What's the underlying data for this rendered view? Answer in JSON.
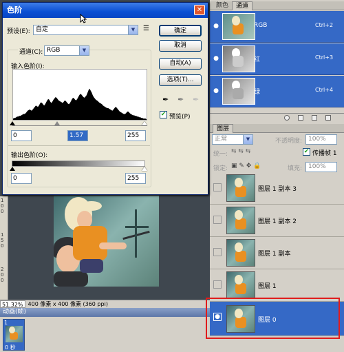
{
  "dialog": {
    "title": "色阶",
    "close_glyph": "✕",
    "preset_label": "预设(E):",
    "preset_value": "自定",
    "channel_label": "通道(C):",
    "channel_value": "RGB",
    "input_levels_label": "输入色阶(I):",
    "input_black": "0",
    "input_gamma": "1.57",
    "input_white": "255",
    "output_levels_label": "输出色阶(O):",
    "output_black": "0",
    "output_white": "255",
    "buttons": {
      "ok": "确定",
      "cancel": "取消",
      "auto": "自动(A)",
      "options": "选项(T)..."
    },
    "preview_label": "预览(P)",
    "preview_checked": true,
    "histogram": [
      2,
      3,
      3,
      4,
      5,
      5,
      6,
      6,
      7,
      8,
      9,
      9,
      10,
      12,
      14,
      15,
      16,
      15,
      14,
      16,
      18,
      20,
      22,
      21,
      20,
      22,
      25,
      27,
      26,
      24,
      22,
      24,
      27,
      30,
      32,
      31,
      28,
      26,
      28,
      31,
      33,
      35,
      34,
      32,
      30,
      29,
      28,
      27,
      26,
      28,
      30,
      29,
      27,
      25,
      24,
      26,
      29,
      32,
      34,
      33,
      31,
      30,
      32,
      35,
      38,
      40,
      39,
      37,
      35,
      34,
      36,
      38,
      42,
      46,
      48,
      45,
      42,
      38,
      35,
      33,
      31,
      30,
      29,
      27,
      26,
      25,
      24,
      22,
      21,
      20,
      19,
      18,
      18,
      17,
      16,
      15,
      14,
      16,
      18,
      20,
      19,
      17,
      15,
      13,
      12,
      11,
      10,
      9,
      9,
      10,
      12,
      13,
      12,
      10,
      9,
      8,
      7,
      7,
      6,
      6,
      5,
      5,
      4,
      4,
      3,
      3,
      2,
      2,
      2,
      1
    ]
  },
  "status_bar": {
    "zoom": "51.32%",
    "doc_info": "400 像素 x 400 像素 (360 ppi)"
  },
  "ruler_marks": [
    "1",
    "0",
    "0",
    "1",
    "5",
    "0",
    "2",
    "0",
    "0"
  ],
  "animation": {
    "title": "动画(帧)",
    "frame_number": "1",
    "frame_time": "0 秒"
  },
  "channels_panel": {
    "tabs": [
      "颜色",
      "通道"
    ],
    "channels": [
      {
        "name": "RGB",
        "shortcut": "Ctrl+2"
      },
      {
        "name": "红",
        "shortcut": "Ctrl+3"
      },
      {
        "name": "绿",
        "shortcut": "Ctrl+4"
      }
    ]
  },
  "layers_panel": {
    "title": "图层",
    "blend_mode": "正常",
    "opacity_label": "不透明度:",
    "opacity_value": "100%",
    "unify_label": "统一:",
    "propagate_label": "传播帧 1",
    "lock_label": "锁定:",
    "fill_label": "填充:",
    "fill_value": "100%",
    "layers": [
      {
        "name": "图层 1 副本 3",
        "visible": false,
        "selected": false
      },
      {
        "name": "图层 1 副本 2",
        "visible": false,
        "selected": false
      },
      {
        "name": "图层 1 副本",
        "visible": false,
        "selected": false
      },
      {
        "name": "图层 1",
        "visible": false,
        "selected": false
      },
      {
        "name": "图层 0",
        "visible": true,
        "selected": true
      }
    ]
  },
  "colors": {
    "selection_blue": "#3569c6",
    "highlight_red": "#e01c1c",
    "title_blue": "#0a4fd3"
  }
}
